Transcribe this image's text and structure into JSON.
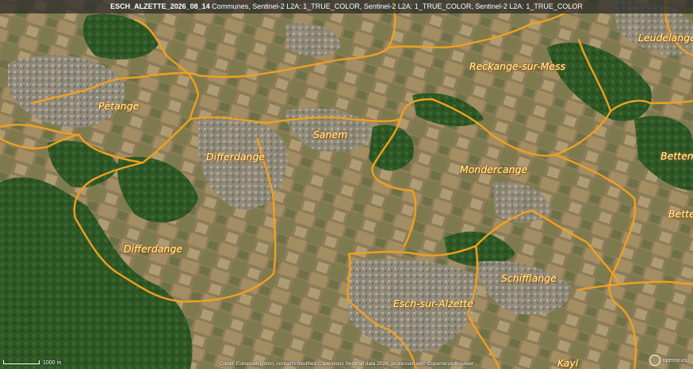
{
  "title": {
    "layer_name": "ESCH_ALZETTE_2026_08_14",
    "description": "Communes, Sentinel-2 L2A: 1_TRUE_COLOR, Sentinel-2 L2A: 1_TRUE_COLOR, Sentinel-2 L2A: 1_TRUE_COLOR"
  },
  "communes": [
    {
      "id": "petange",
      "label": "Pétange"
    },
    {
      "id": "differdange-north",
      "label": "Differdange"
    },
    {
      "id": "sanem",
      "label": "Sanem"
    },
    {
      "id": "reckange",
      "label": "Reckange-sur-Mess"
    },
    {
      "id": "leudelange",
      "label": "Leudelange"
    },
    {
      "id": "mondercange",
      "label": "Mondercange"
    },
    {
      "id": "bettembourg",
      "label": "Bettem"
    },
    {
      "id": "bettembourg-2",
      "label": "Bette"
    },
    {
      "id": "differdange-south",
      "label": "Differdange"
    },
    {
      "id": "schifflange",
      "label": "Schifflange"
    },
    {
      "id": "esch",
      "label": "Esch-sur-Alzette"
    },
    {
      "id": "kayl",
      "label": "Kayl"
    }
  ],
  "scale": {
    "label": "1000 m"
  },
  "credit": "Credit: European Union, contains modified Copernicus Sentinel data 2026, processed with Copernicus Browser",
  "logo": {
    "text": "opernicus"
  },
  "colors": {
    "boundary": "#f0a020",
    "forest": "#2f5a27",
    "fields": "#8b7a55",
    "urban": "#9a958a"
  }
}
